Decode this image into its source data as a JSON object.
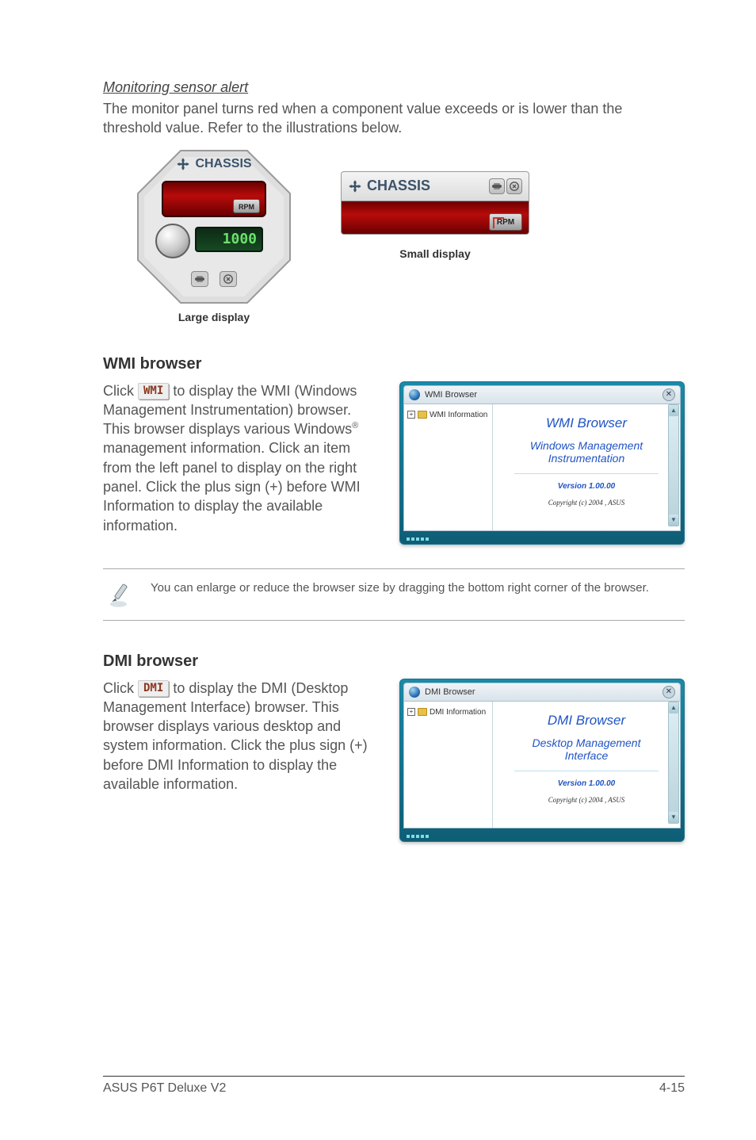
{
  "monitoring": {
    "heading": "Monitoring sensor alert",
    "text": "The monitor panel turns red when a component value exceeds or is lower than the threshold value. Refer to the illustrations below.",
    "large": {
      "label": "CHASSIS",
      "rpm_chip": "RPM",
      "lcd_value": "1000",
      "caption": "Large display"
    },
    "small": {
      "label": "CHASSIS",
      "rpm_chip": "RPM",
      "caption": "Small display"
    }
  },
  "wmi": {
    "title": "WMI browser",
    "btn_label": "WMI",
    "text_before": "Click ",
    "text_after_1": " to display the WMI (Windows Management Instrumentation) browser. This browser displays various Windows",
    "sup": "®",
    "text_after_2": " management information. Click an item from the left panel to display on the right panel. Click the plus sign (+) before WMI Information to display the available information.",
    "window": {
      "title": "WMI Browser",
      "tree_label": "WMI Information",
      "content_title": "WMI Browser",
      "subtitle_line1": "Windows Management",
      "subtitle_line2": "Instrumentation",
      "version": "Version 1.00.00",
      "copyright": "Copyright (c) 2004 ,  ASUS"
    }
  },
  "note": {
    "text": "You can enlarge or reduce the browser size by dragging the bottom right corner of the browser."
  },
  "dmi": {
    "title": "DMI browser",
    "btn_label": "DMI",
    "text_before": "Click ",
    "text_after": " to display the DMI (Desktop Management Interface) browser. This browser displays various desktop and system information. Click the plus sign (+) before DMI Information to display the available information.",
    "window": {
      "title": "DMI Browser",
      "tree_label": "DMI Information",
      "content_title": "DMI Browser",
      "subtitle_line1": "Desktop Management",
      "subtitle_line2": "Interface",
      "version": "Version 1.00.00",
      "copyright": "Copyright (c) 2004 ,  ASUS"
    }
  },
  "footer": {
    "left": "ASUS P6T Deluxe V2",
    "right": "4-15"
  }
}
